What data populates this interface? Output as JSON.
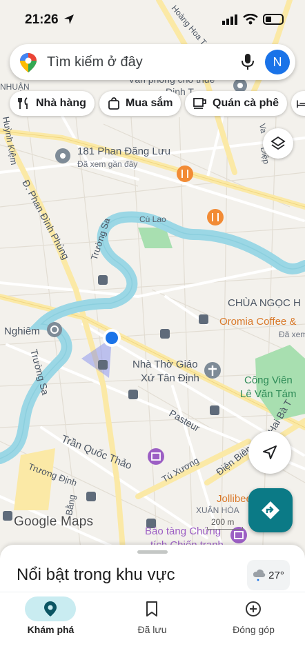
{
  "status_bar": {
    "time": "21:26"
  },
  "search": {
    "placeholder": "Tìm kiếm ở đây",
    "avatar_initial": "N"
  },
  "chips": [
    {
      "label": "Nhà hàng",
      "icon": "fork-knife-icon"
    },
    {
      "label": "Mua sắm",
      "icon": "shopping-bag-icon"
    },
    {
      "label": "Quán cà phê",
      "icon": "coffee-cup-icon"
    }
  ],
  "map": {
    "labels": {
      "place_181": "181 Phan Đăng Lưu",
      "place_181_sub": "Đã xem gần đây",
      "chua_ngoc": "CHÙA NGỌC H",
      "oromia": "Oromia Coffee &",
      "oromia_sub": "Đã xem",
      "nha_tho_1": "Nhà Thờ Giáo",
      "nha_tho_2": "Xứ Tân Định",
      "cong_vien_1": "Công Viên",
      "cong_vien_2": "Lê Văn Tám",
      "jollibee": "Jollibee Pa",
      "xuan_hoa": "XUÂN HÒA",
      "bao_tang_1": "Bảo tàng Chứng",
      "bao_tang_2": "tích Chiến tranh",
      "van_phong": "Văn phòng cho thuê",
      "dinh_t": "Đinh T",
      "nhuan": "NHUẬN",
      "nghiem": "Nghiêm",
      "cu_lao": "Cù Lao",
      "truong_sa_1": "Trường Sa",
      "truong_sa_2": "Trường Sa",
      "phan_dinh_phung": "Đ. Phan Đình Phùng",
      "huynh_kiem": "Huỳnh Kiệm",
      "pasteur": "Pasteur",
      "dien_bien_phu": "Điện Biên Phủ",
      "hai_ba_t": "Hai Bà T",
      "tran_quoc_thao": "Trần Quốc Thảo",
      "truong_dinh": "Trương Định",
      "tu_xuong": "Tú Xương",
      "hoang_hoa": "Hoàng Hoa T",
      "diep": "Điệp",
      "va": "Va",
      "bang": "Bằng"
    },
    "scale_label": "200 m",
    "attribution": "Google Maps"
  },
  "sheet": {
    "title": "Nổi bật trong khu vực",
    "temperature": "27°"
  },
  "tabs": [
    {
      "label": "Khám phá",
      "active": true
    },
    {
      "label": "Đã lưu",
      "active": false
    },
    {
      "label": "Đóng góp",
      "active": false
    }
  ],
  "colors": {
    "water": "#9bd7e5",
    "land": "#f3f1ec",
    "park": "#a8dfb0",
    "accent": "#0b7a86",
    "food_pin": "#f28b35",
    "poi_purple": "#9c5fc4",
    "transit": "#5f6b7a",
    "location": "#1a73e8"
  }
}
